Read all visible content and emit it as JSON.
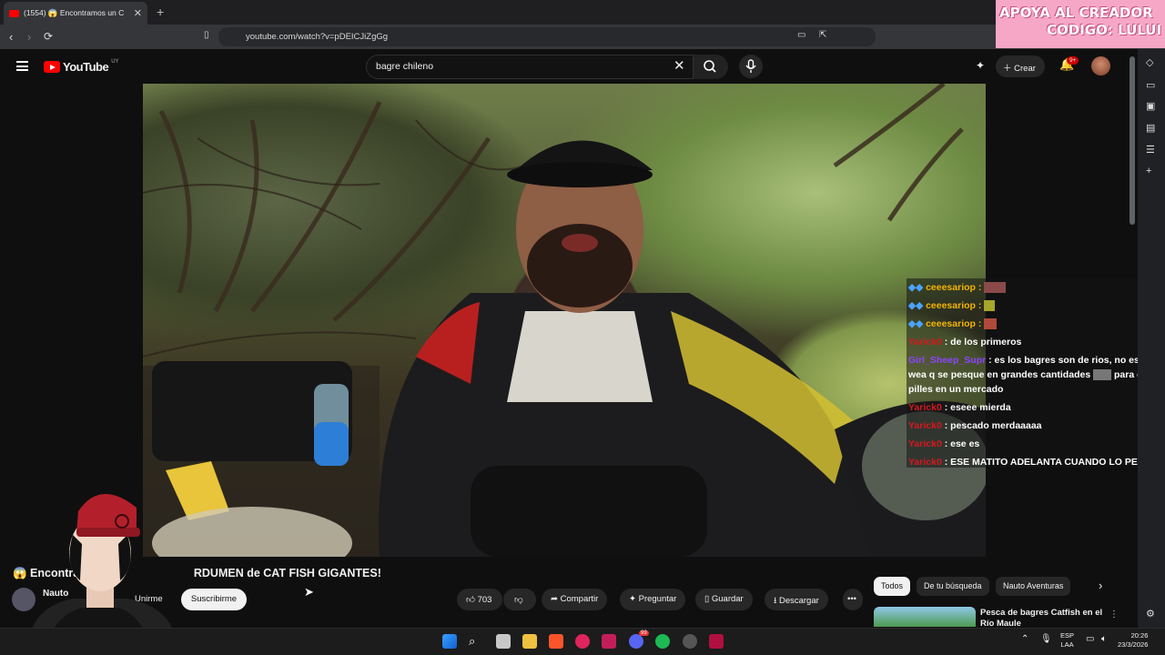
{
  "browser": {
    "tab_title": "(1554) 😱 Encontramos un C",
    "new_tab": "+",
    "url": "youtube.com/watch?v=pDEICJiZgGg",
    "tab_close": "✕"
  },
  "overlay_promo": {
    "line1": "APOYA AL CREADOR",
    "line2": "CODIGO: LULUI"
  },
  "youtube_header": {
    "logo_text": "YouTube",
    "country_code": "UY",
    "search_value": "bagre chileno",
    "create_label": "Crear",
    "notification_badge": "9+"
  },
  "stream_chat": {
    "messages": [
      {
        "user": "ceeesariop :",
        "text": "",
        "user_color": "#f4b400"
      },
      {
        "user": "ceeesariop :",
        "text": "",
        "user_color": "#f4b400"
      },
      {
        "user": "ceeesariop :",
        "text": "",
        "user_color": "#f4b400"
      },
      {
        "user": "Yarick0",
        "text": ": de los primeros",
        "user_color": "#d6181e"
      },
      {
        "user": "Girl_Sheep_Supr",
        "text": ": es los bagres son de rios, no es una wea q se pesque en grandes cantidades",
        "text2": "para q te lo pilles en un mercado",
        "user_color": "#8e44ff"
      },
      {
        "user": "Yarick0",
        "text": ": eseee mierda",
        "user_color": "#d6181e"
      },
      {
        "user": "Yarick0",
        "text": ": pescado merdaaaaa",
        "user_color": "#d6181e"
      },
      {
        "user": "Yarick0",
        "text": ": ese es",
        "user_color": "#d6181e"
      },
      {
        "user": "Yarick0",
        "text": ": ESE MATITO ADELANTA CUANDO LO PESQUE",
        "user_color": "#d6181e"
      }
    ]
  },
  "video": {
    "title_start": "😱 Encontran",
    "title_end": "RDUMEN de CAT FISH GIGANTES!",
    "channel_name": "Nauto",
    "join_label": "Unirme",
    "subscribe_label": "Suscribirme",
    "likes": "703",
    "share_label": "Compartir",
    "ask_label": "Preguntar",
    "save_label": "Guardar",
    "download_label": "Descargar"
  },
  "filters": {
    "chips": [
      "Todos",
      "De tu búsqueda",
      "Nauto Aventuras"
    ]
  },
  "recommendation": {
    "title": "Pesca de bagres Catfish en el Río Maule"
  },
  "taskbar": {
    "lang_line1": "ESP",
    "lang_line2": "LAA",
    "time": "20:26",
    "date": "23/3/2026",
    "discord_badge": "99"
  }
}
